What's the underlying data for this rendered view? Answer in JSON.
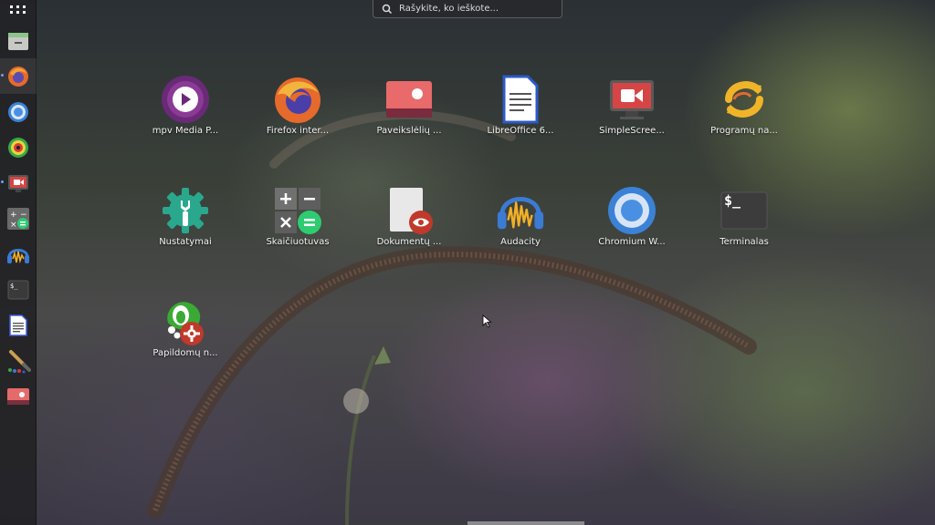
{
  "search": {
    "placeholder": "Rašykite, ko ieškote..."
  },
  "dock": {
    "items": [
      {
        "name": "app-grid",
        "icon": "grid-icon"
      },
      {
        "name": "files",
        "icon": "file-manager-icon"
      },
      {
        "name": "firefox",
        "icon": "firefox-icon"
      },
      {
        "name": "chromium",
        "icon": "chromium-icon"
      },
      {
        "name": "color-picker",
        "icon": "color-wheel-icon"
      },
      {
        "name": "simplescreenrecorder",
        "icon": "screen-recorder-icon"
      },
      {
        "name": "calculator",
        "icon": "calculator-icon"
      },
      {
        "name": "audacity",
        "icon": "audacity-icon"
      },
      {
        "name": "terminal",
        "icon": "terminal-icon"
      },
      {
        "name": "libreoffice-writer",
        "icon": "document-icon"
      },
      {
        "name": "paint",
        "icon": "paint-brush-icon"
      },
      {
        "name": "image-viewer",
        "icon": "image-viewer-icon"
      }
    ]
  },
  "apps": [
    {
      "label": "mpv Media P...",
      "icon": "mpv-icon"
    },
    {
      "label": "Firefox inter...",
      "icon": "firefox-icon"
    },
    {
      "label": "Paveikslėlių ...",
      "icon": "image-viewer-icon"
    },
    {
      "label": "LibreOffice 6...",
      "icon": "libreoffice-writer-icon"
    },
    {
      "label": "SimpleScree...",
      "icon": "screen-recorder-icon"
    },
    {
      "label": "Programų na...",
      "icon": "software-updater-icon"
    },
    {
      "label": "Nustatymai",
      "icon": "settings-icon"
    },
    {
      "label": "Skaičiuotuvas",
      "icon": "calculator-icon"
    },
    {
      "label": "Dokumentų ...",
      "icon": "document-viewer-icon"
    },
    {
      "label": "Audacity",
      "icon": "audacity-icon"
    },
    {
      "label": "Chromium W...",
      "icon": "chromium-icon"
    },
    {
      "label": "Terminalas",
      "icon": "terminal-icon"
    },
    {
      "label": "Papildomų n...",
      "icon": "additional-drivers-icon"
    }
  ],
  "terminal_prompt": "$_",
  "colors": {
    "dock_bg": "#232326",
    "accent": "#6aa0ff",
    "label": "#f2f2f2"
  }
}
